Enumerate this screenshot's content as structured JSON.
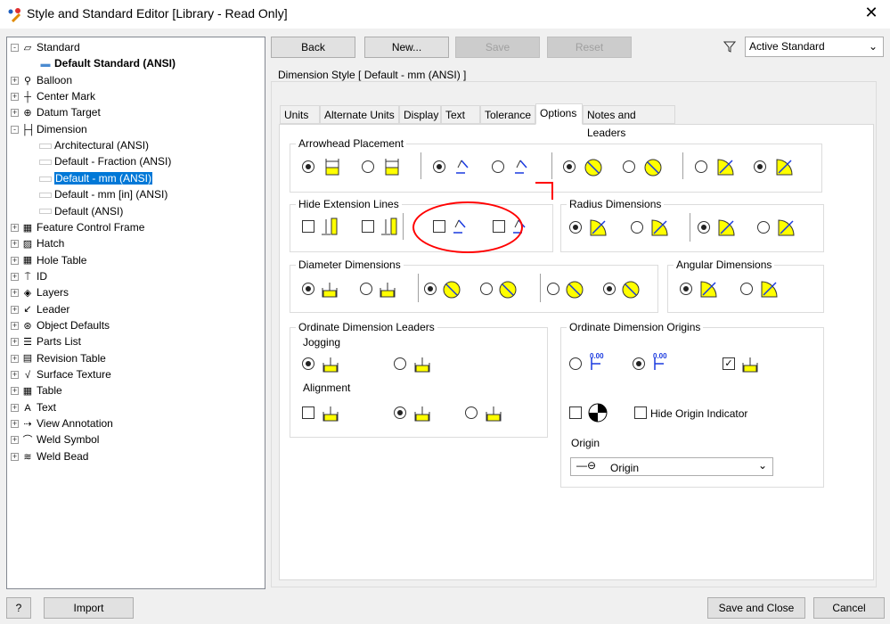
{
  "window": {
    "title": "Style and Standard Editor [Library - Read Only]",
    "close": "✕"
  },
  "tree": [
    {
      "label": "Standard",
      "icon": "standard-icon",
      "level": 0,
      "expander": "-"
    },
    {
      "label": "Default Standard (ANSI)",
      "icon": "standard-item-icon",
      "level": 1,
      "bold": true
    },
    {
      "label": "Balloon",
      "icon": "balloon-icon",
      "level": 0,
      "expander": "+"
    },
    {
      "label": "Center Mark",
      "icon": "center-mark-icon",
      "level": 0,
      "expander": "+"
    },
    {
      "label": "Datum Target",
      "icon": "datum-target-icon",
      "level": 0,
      "expander": "+"
    },
    {
      "label": "Dimension",
      "icon": "dimension-icon",
      "level": 0,
      "expander": "-"
    },
    {
      "label": "Architectural (ANSI)",
      "level": 1
    },
    {
      "label": "Default - Fraction (ANSI)",
      "level": 1
    },
    {
      "label": "Default - mm (ANSI)",
      "level": 1,
      "selected": true
    },
    {
      "label": "Default - mm [in] (ANSI)",
      "level": 1
    },
    {
      "label": "Default (ANSI)",
      "level": 1
    },
    {
      "label": "Feature Control Frame",
      "icon": "fcf-icon",
      "level": 0,
      "expander": "+"
    },
    {
      "label": "Hatch",
      "icon": "hatch-icon",
      "level": 0,
      "expander": "+"
    },
    {
      "label": "Hole Table",
      "icon": "hole-table-icon",
      "level": 0,
      "expander": "+"
    },
    {
      "label": "ID",
      "icon": "id-icon",
      "level": 0,
      "expander": "+"
    },
    {
      "label": "Layers",
      "icon": "layers-icon",
      "level": 0,
      "expander": "+"
    },
    {
      "label": "Leader",
      "icon": "leader-icon",
      "level": 0,
      "expander": "+"
    },
    {
      "label": "Object Defaults",
      "icon": "object-defaults-icon",
      "level": 0,
      "expander": "+"
    },
    {
      "label": "Parts List",
      "icon": "parts-list-icon",
      "level": 0,
      "expander": "+"
    },
    {
      "label": "Revision Table",
      "icon": "revision-table-icon",
      "level": 0,
      "expander": "+"
    },
    {
      "label": "Surface Texture",
      "icon": "surface-texture-icon",
      "level": 0,
      "expander": "+"
    },
    {
      "label": "Table",
      "icon": "table-icon",
      "level": 0,
      "expander": "+"
    },
    {
      "label": "Text",
      "icon": "text-icon",
      "level": 0,
      "expander": "+"
    },
    {
      "label": "View Annotation",
      "icon": "view-annotation-icon",
      "level": 0,
      "expander": "+"
    },
    {
      "label": "Weld Symbol",
      "icon": "weld-symbol-icon",
      "level": 0,
      "expander": "+"
    },
    {
      "label": "Weld Bead",
      "icon": "weld-bead-icon",
      "level": 0,
      "expander": "+"
    }
  ],
  "toolbar": {
    "back": "Back",
    "new": "New...",
    "save": "Save",
    "reset": "Reset",
    "filter": "Active Standard"
  },
  "style_title": "Dimension Style [ Default - mm (ANSI) ]",
  "tabs": [
    "Units",
    "Alternate Units",
    "Display",
    "Text",
    "Tolerance",
    "Options",
    "Notes and Leaders"
  ],
  "active_tab": "Options",
  "groups": {
    "arrowhead": "Arrowhead Placement",
    "hide_ext": "Hide Extension Lines",
    "radius": "Radius Dimensions",
    "diameter": "Diameter Dimensions",
    "angular": "Angular Dimensions",
    "ordinate_leaders": "Ordinate Dimension Leaders",
    "jogging": "Jogging",
    "alignment": "Alignment",
    "ordinate_origins": "Ordinate Dimension Origins",
    "hide_origin": "Hide Origin Indicator",
    "origin_label": "Origin",
    "origin_value": "Origin",
    "origin_num": "0.00"
  },
  "bottom": {
    "help": "?",
    "import": "Import",
    "save_close": "Save and Close",
    "cancel": "Cancel"
  },
  "colors": {
    "accent": "#0078d7",
    "yellow": "#ffff00",
    "annotation": "#ff0000"
  }
}
